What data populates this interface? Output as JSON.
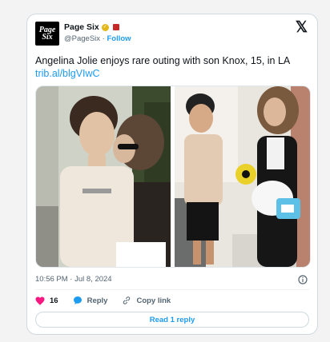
{
  "account": {
    "avatar_line1": "Page",
    "avatar_line2": "Six",
    "name": "Page Six",
    "handle": "@PageSix",
    "separator": "·",
    "follow_label": "Follow"
  },
  "tweet": {
    "text": "Angelina Jolie enjoys rare outing with son Knox, 15, in LA",
    "link": "trib.al/blgVIwC",
    "timestamp": "10:56 PM · Jul 8, 2024"
  },
  "actions": {
    "like_count": "16",
    "reply_label": "Reply",
    "copy_label": "Copy link",
    "read_reply_label": "Read 1 reply"
  },
  "icons": {
    "brand": "x-logo-icon",
    "verified": "gold-verified-badge-icon",
    "affiliate": "affiliate-badge-icon",
    "like": "heart-icon",
    "reply": "reply-bubble-icon",
    "copy": "link-icon",
    "info": "info-icon"
  },
  "colors": {
    "link_blue": "#1d9bf0",
    "heart_pink": "#f91880",
    "muted": "#536471"
  }
}
